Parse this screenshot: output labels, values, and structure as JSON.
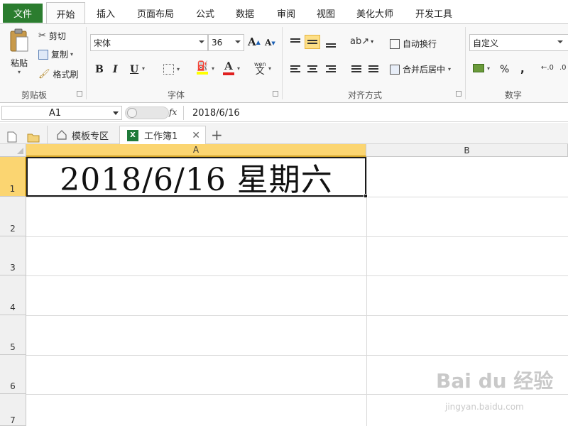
{
  "menu": {
    "file": "文件",
    "tabs": [
      "开始",
      "插入",
      "页面布局",
      "公式",
      "数据",
      "审阅",
      "视图",
      "美化大师",
      "开发工具"
    ],
    "active": "开始"
  },
  "ribbon": {
    "clipboard": {
      "paste": "粘贴",
      "cut": "剪切",
      "copy": "复制",
      "format_painter": "格式刷",
      "label": "剪贴板"
    },
    "font": {
      "name": "宋体",
      "size": "36",
      "label": "字体",
      "bold": "B",
      "italic": "I",
      "underline": "U",
      "grow": "A",
      "shrink": "A",
      "font_color": "A",
      "phonetic": "wen"
    },
    "alignment": {
      "wrap": "自动换行",
      "merge": "合并后居中",
      "label": "对齐方式"
    },
    "number": {
      "format": "自定义",
      "percent": "%",
      "comma": ",",
      "label": "数字"
    }
  },
  "formula_bar": {
    "name_box": "A1",
    "fx": "fx",
    "value": "2018/6/16"
  },
  "doc_tabs": {
    "templates": "模板专区",
    "workbook": "工作簿1",
    "add": "+"
  },
  "grid": {
    "columns": [
      "A",
      "B"
    ],
    "rows": [
      "1",
      "2",
      "3",
      "4",
      "5",
      "6",
      "7"
    ],
    "cell_a1": "2018/6/16  星期六"
  },
  "watermark": {
    "main": "Bai du 经验",
    "sub": "jingyan.baidu.com"
  },
  "colors": {
    "file_tab": "#2b7d2f",
    "selection": "#fbd571",
    "highlight_button": "#fddf86",
    "top_accent": "#e02020"
  }
}
